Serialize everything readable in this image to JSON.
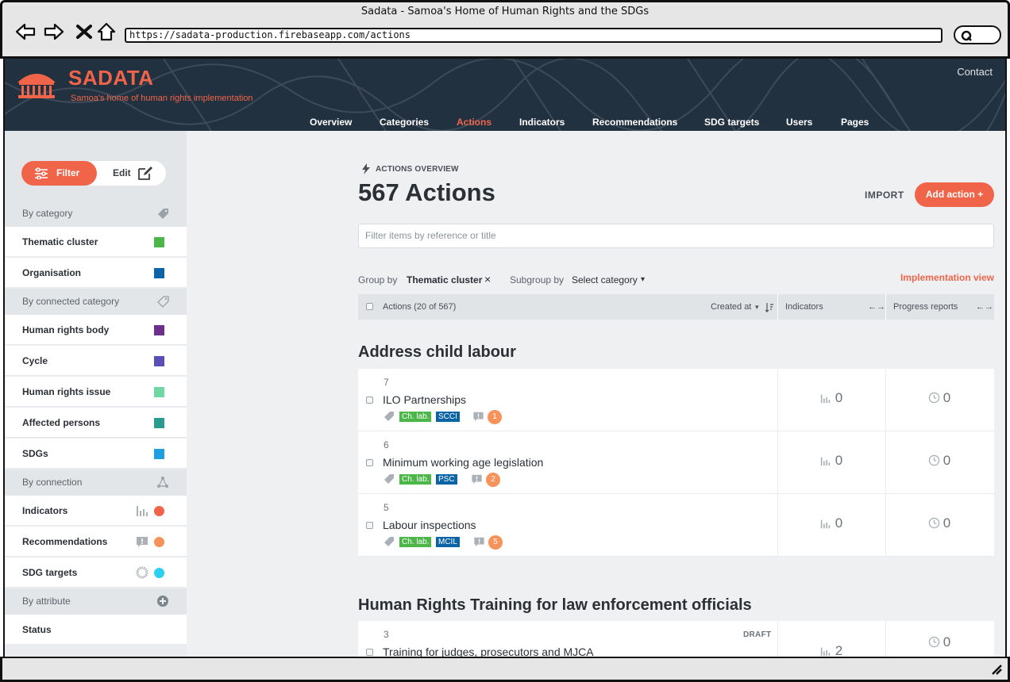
{
  "browser": {
    "window_title": "Sadata - Samoa's Home of Human Rights and the SDGs",
    "url": "https://sadata-production.firebaseapp.com/actions"
  },
  "header": {
    "brand_title": "SADATA",
    "brand_subtitle": "Samoa's home of human rights implementation",
    "contact": "Contact",
    "nav": [
      {
        "label": "Overview",
        "active": false
      },
      {
        "label": "Categories",
        "active": false
      },
      {
        "label": "Actions",
        "active": true
      },
      {
        "label": "Indicators",
        "active": false
      },
      {
        "label": "Recommendations",
        "active": false
      },
      {
        "label": "SDG targets",
        "active": false
      },
      {
        "label": "Users",
        "active": false
      },
      {
        "label": "Pages",
        "active": false
      }
    ]
  },
  "sidebar": {
    "filter_label": "Filter",
    "edit_label": "Edit",
    "by_category": "By category",
    "category_items": [
      {
        "label": "Thematic cluster",
        "color": "#4bb748"
      },
      {
        "label": "Organisation",
        "color": "#0b64a6"
      }
    ],
    "by_connected_category": "By connected category",
    "connected_items": [
      {
        "label": "Human rights body",
        "color": "#6d2f8c"
      },
      {
        "label": "Cycle",
        "color": "#5a4fb5"
      },
      {
        "label": "Human rights issue",
        "color": "#6fd7a5"
      },
      {
        "label": "Affected persons",
        "color": "#2a9b8f"
      },
      {
        "label": "SDGs",
        "color": "#1f9ee0"
      }
    ],
    "by_connection": "By connection",
    "connection_items": [
      {
        "label": "Indicators",
        "icon": "indicator-bars-icon",
        "color": "#f0654a"
      },
      {
        "label": "Recommendations",
        "icon": "recommendation-icon",
        "color": "#f7925b"
      },
      {
        "label": "SDG targets",
        "icon": "sdg-wheel-icon",
        "color": "#2dd0f0"
      }
    ],
    "by_attribute": "By attribute",
    "attribute_items": [
      {
        "label": "Status"
      }
    ]
  },
  "main": {
    "overview_label": "ACTIONS OVERVIEW",
    "title": "567 Actions",
    "import_label": "IMPORT",
    "add_label": "Add action +",
    "search_placeholder": "Filter items by reference or title",
    "group_by_label": "Group by",
    "group_by_value": "Thematic cluster",
    "group_remove": "×",
    "subgroup_label": "Subgroup by",
    "subgroup_value": "Select category",
    "subgroup_caret": "▾",
    "implementation_view": "Implementation view",
    "table_header": {
      "actions": "Actions (20 of 567)",
      "created_at": "Created at",
      "sort_caret": "▾",
      "indicators": "Indicators",
      "progress": "Progress reports",
      "expand": "←→"
    },
    "groups": [
      {
        "title": "Address child labour",
        "rows": [
          {
            "ref": "7",
            "title": "ILO Partnerships",
            "tag1": "Ch. lab.",
            "tag2": "SCCI",
            "recs": "1",
            "indicators": "0",
            "progress": "0"
          },
          {
            "ref": "6",
            "title": "Minimum working age legislation",
            "tag1": "Ch. lab.",
            "tag2": "PSC",
            "recs": "2",
            "indicators": "0",
            "progress": "0"
          },
          {
            "ref": "5",
            "title": "Labour inspections",
            "tag1": "Ch. lab.",
            "tag2": "MCIL",
            "recs": "5",
            "indicators": "0",
            "progress": "0"
          }
        ]
      },
      {
        "title": "Human Rights Training for law enforcement officials",
        "rows": [
          {
            "ref": "3",
            "title": "Training for judges, prosecutors and MJCA",
            "status": "DRAFT",
            "indicators": "2",
            "progress": "0"
          }
        ]
      }
    ]
  },
  "colors": {
    "accent": "#f0654a",
    "header_bg": "#22313f",
    "tag_green": "#4bb748",
    "tag_blue": "#0b64a6",
    "badge": "#f7925b"
  }
}
